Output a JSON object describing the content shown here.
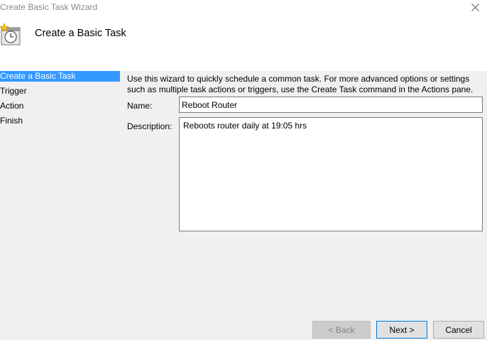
{
  "window": {
    "title": "Create Basic Task Wizard",
    "close_glyph": "✕"
  },
  "header": {
    "title": "Create a Basic Task",
    "icon": "clock-star-icon"
  },
  "nav": {
    "items": [
      {
        "label": "Create a Basic Task",
        "active": true
      },
      {
        "label": "Trigger",
        "active": false
      },
      {
        "label": "Action",
        "active": false
      },
      {
        "label": "Finish",
        "active": false
      }
    ]
  },
  "content": {
    "intro_line1": "Use this wizard to quickly schedule a common task.  For more advanced options or settings",
    "intro_line2": "such as multiple task actions or triggers, use the Create Task command in the Actions pane.",
    "name_label": "Name:",
    "name_value": "Reboot Router",
    "description_label": "Description:",
    "description_value": "Reboots router daily at 19:05 hrs"
  },
  "buttons": {
    "back": "< Back",
    "next": "Next >",
    "cancel": "Cancel"
  },
  "colors": {
    "accent": "#3399ff",
    "focus_border": "#0078d7"
  }
}
